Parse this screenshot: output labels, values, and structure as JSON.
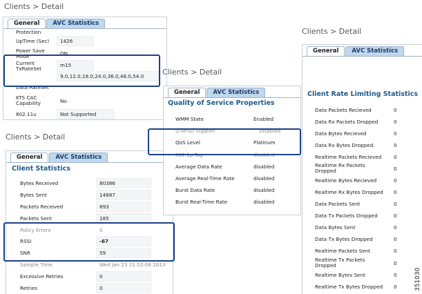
{
  "breadcrumb": "Clients > Detail",
  "tabs": {
    "general": "General",
    "avc": "AVC Statistics"
  },
  "p1": {
    "rows": [
      {
        "label": "Protection",
        "value": ""
      },
      {
        "label": "UpTime (Sec)",
        "value": "1426"
      },
      {
        "label": "Power Save Mode",
        "value": "ON"
      },
      {
        "label": "Current TxRateSet",
        "value": "m15"
      },
      {
        "label": "",
        "value": "9.0,12.0,18.0,24.0,36.0,48.0,54.0"
      },
      {
        "label": "Data RateSet",
        "value": ""
      },
      {
        "label": "KTS CAC Capability",
        "value": "No"
      },
      {
        "label": "802.11u",
        "value": "Not Supported"
      }
    ]
  },
  "p2": {
    "title": "Client Statistics",
    "rows": [
      {
        "label": "Bytes Received",
        "value": "80386"
      },
      {
        "label": "Bytes Sent",
        "value": "14887"
      },
      {
        "label": "Packets Received",
        "value": "893"
      },
      {
        "label": "Packets Sent",
        "value": "185"
      },
      {
        "label": "Policy Errors",
        "value": "0"
      },
      {
        "label": "RSSI",
        "value": "-67"
      },
      {
        "label": "SNR",
        "value": "59"
      },
      {
        "label": "Sample Time",
        "value": "Wed Jan 23 21:52:06 2013"
      },
      {
        "label": "Excessive Retries",
        "value": "0"
      },
      {
        "label": "Retries",
        "value": "0"
      }
    ]
  },
  "p3": {
    "title": "Quality of Service Properties",
    "rows": [
      {
        "label": "WMM State",
        "value": "Enabled"
      },
      {
        "label": "U-APSD Support",
        "value": "Disabled"
      },
      {
        "label": "QoS Level",
        "value": "Platinum"
      },
      {
        "label": "802.1p Tag",
        "value": "disabled"
      },
      {
        "label": "Average Data Rate",
        "value": "disabled"
      },
      {
        "label": "Average Real-Time Rate",
        "value": "disabled"
      },
      {
        "label": "Burst Data Rate",
        "value": "disabled"
      },
      {
        "label": "Burst Real-Time Rate",
        "value": "disabled"
      }
    ]
  },
  "p4": {
    "title": "Client Rate Limiting Statistics",
    "rows": [
      {
        "label": "Data Packets Recieved",
        "value": "0"
      },
      {
        "label": "Data Rx Packets Dropped",
        "value": "0"
      },
      {
        "label": "Data Bytes Recieved",
        "value": "0"
      },
      {
        "label": "Data Rx Bytes Dropped.",
        "value": "0"
      },
      {
        "label": "Realtime Packets Recieved",
        "value": "0"
      },
      {
        "label": "Realtime Rx Packets Dropped",
        "value": "0"
      },
      {
        "label": "Realtime Bytes Recieved",
        "value": "0"
      },
      {
        "label": "Realtime Rx Bytes Dropped",
        "value": "0"
      },
      {
        "label": "Data Packets Sent",
        "value": "0"
      },
      {
        "label": "Data Tx Packets Dropped",
        "value": "0"
      },
      {
        "label": "Data Bytes Sent",
        "value": "0"
      },
      {
        "label": "Data Tx Bytes Dropped",
        "value": "0"
      },
      {
        "label": "Realtime Packets Sent",
        "value": "0"
      },
      {
        "label": "Realtime Tx Packets Dropped",
        "value": "0"
      },
      {
        "label": "Realtime Bytes Sent",
        "value": "0"
      },
      {
        "label": "Realtime Tx Bytes Dropped",
        "value": "0"
      }
    ]
  },
  "figure_id": "351030"
}
